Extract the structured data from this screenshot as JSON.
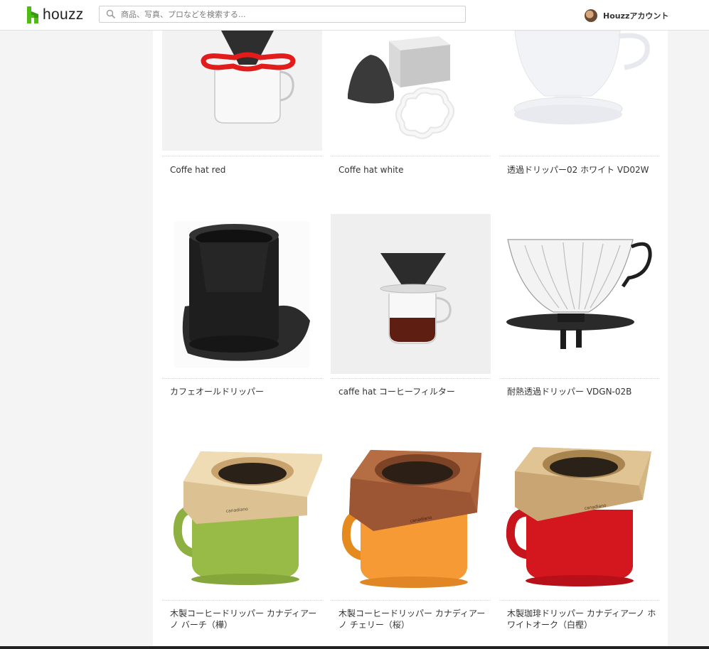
{
  "header": {
    "logo_text": "houzz",
    "search_placeholder": "商品、写真、プロなどを検索する...",
    "account_label": "Houzzアカウント"
  },
  "products": [
    {
      "title": "Coffe hat red"
    },
    {
      "title": "Coffe hat white"
    },
    {
      "title": "透過ドリッパー02 ホワイト VD02W"
    },
    {
      "title": "カフェオールドリッパー"
    },
    {
      "title": "caffe hat コーヒーフィルター"
    },
    {
      "title": "耐熱透過ドリッパー VDGN-02B"
    },
    {
      "title": "木製コーヒードリッパー カナディアーノ バーチ（樺）"
    },
    {
      "title": "木製コーヒードリッパー カナディアーノ チェリー（桜）"
    },
    {
      "title": "木製珈琲ドリッパー カナディアーノ ホワイトオーク（白樫）"
    }
  ],
  "brand_stamp": "canadiano"
}
